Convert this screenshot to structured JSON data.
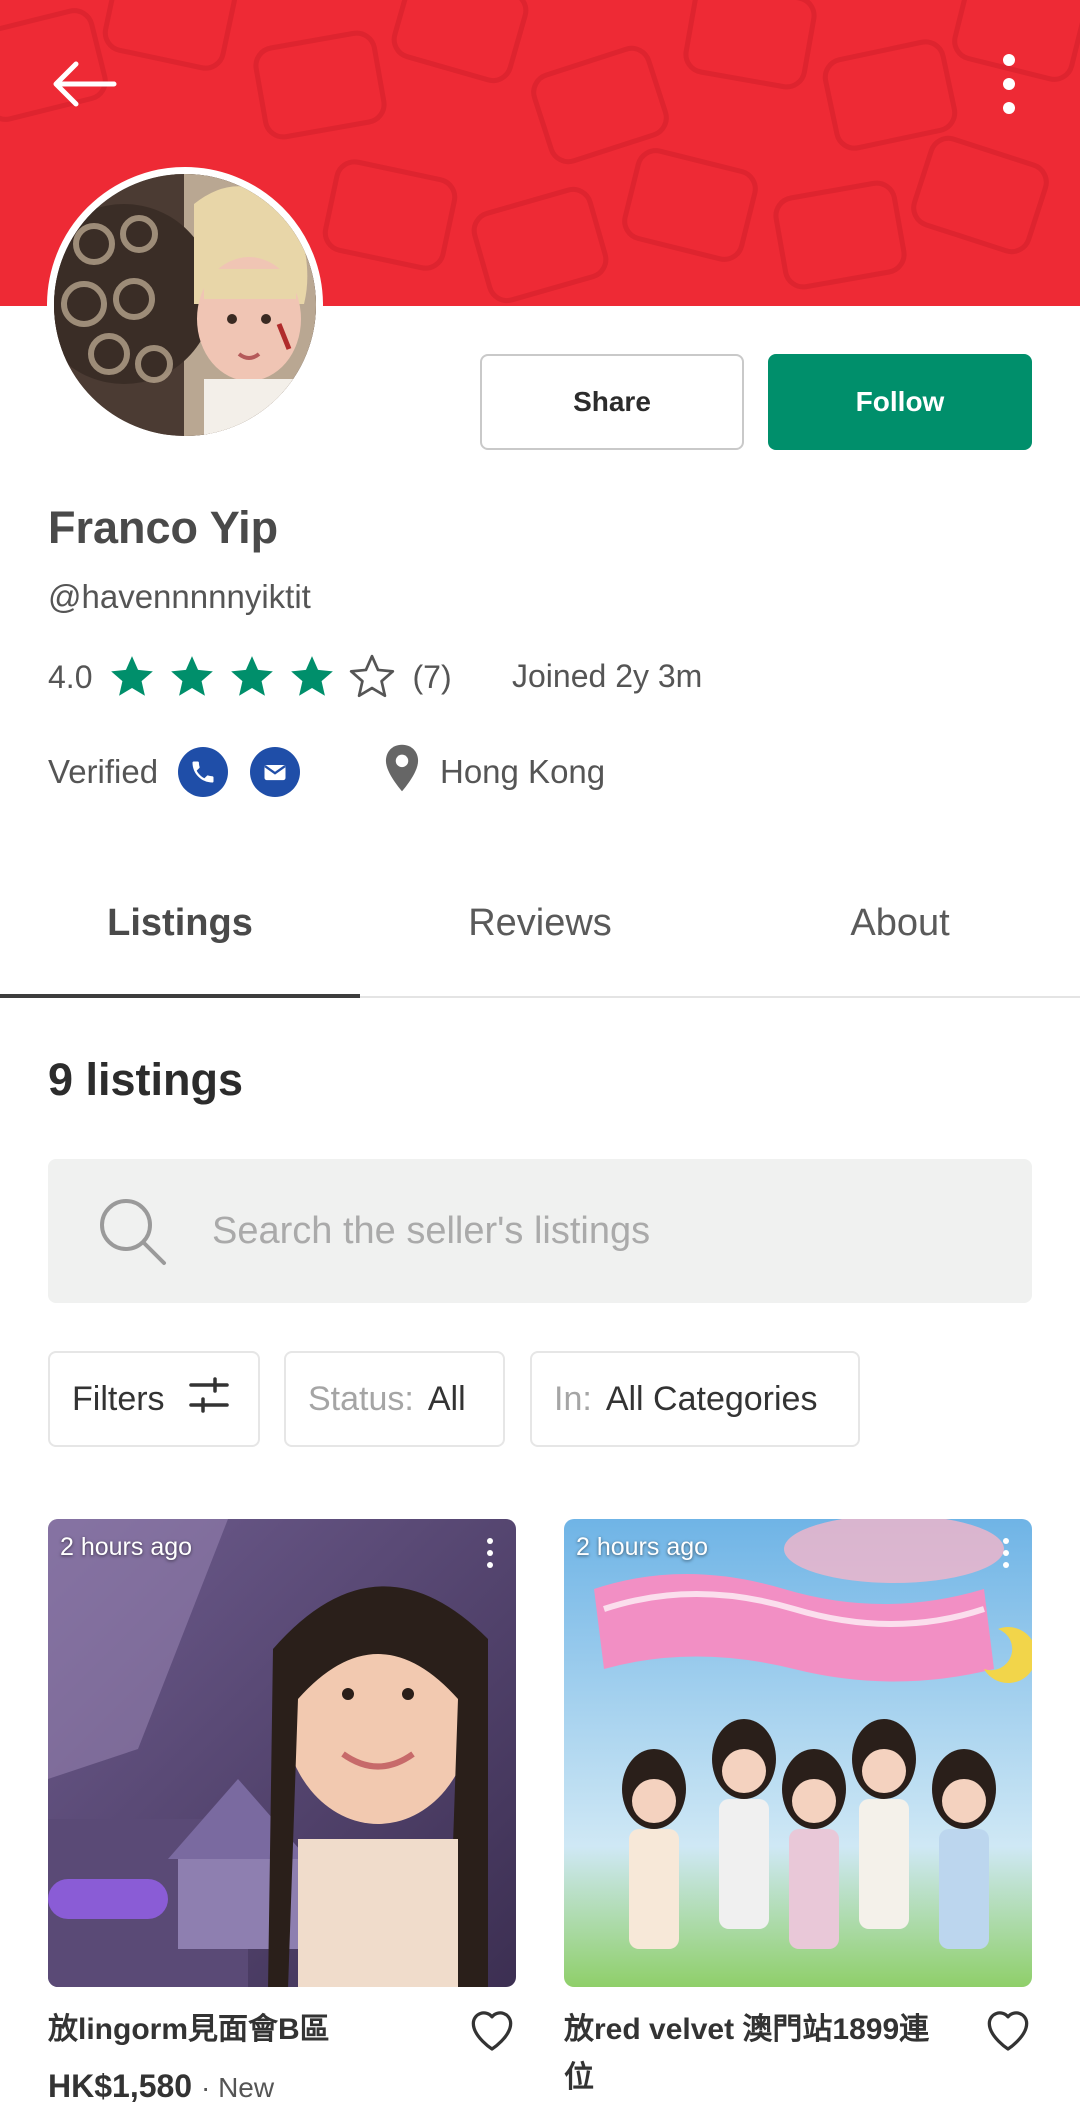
{
  "profile": {
    "name": "Franco Yip",
    "handle": "@havennnnnyiktit",
    "rating": "4.0",
    "rating_value": 4,
    "rating_max": 5,
    "review_count": "(7)",
    "joined": "Joined 2y 3m",
    "verified_label": "Verified",
    "verified_icons": [
      "phone-icon",
      "email-icon"
    ],
    "location": "Hong Kong"
  },
  "actions": {
    "share_label": "Share",
    "follow_label": "Follow"
  },
  "tabs": [
    {
      "label": "Listings",
      "active": true
    },
    {
      "label": "Reviews",
      "active": false
    },
    {
      "label": "About",
      "active": false
    }
  ],
  "listings": {
    "count_label": "9 listings",
    "search_placeholder": "Search the seller's listings",
    "filters_label": "Filters",
    "status_prefix": "Status:",
    "status_value": "All",
    "in_prefix": "In:",
    "in_value": "All Categories",
    "items": [
      {
        "time": "2 hours ago",
        "title": "放lingorm見面會B區",
        "price": "HK$1,580",
        "condition": "· New"
      },
      {
        "time": "2 hours ago",
        "title": "放red velvet 澳門站1899連位"
      }
    ]
  },
  "colors": {
    "banner": "#ee2a35",
    "accent": "#008f6b",
    "verified": "#1f4ea8"
  }
}
